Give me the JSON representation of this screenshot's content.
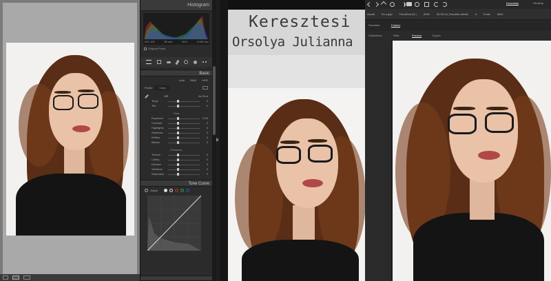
{
  "lightroom": {
    "panel_title": "Histogram",
    "original_photo_label": "Original Photo",
    "hist_info": [
      "ISO 100",
      "85 mm",
      "f/8.0",
      "1/160 sec"
    ],
    "basic_title": "Basic",
    "treatment_modes": [
      "Auto",
      "B&W",
      "HDR"
    ],
    "profile_label": "Profile",
    "profile_value": "Color",
    "wb_label": "WB",
    "wb_value": "As Shot",
    "sliders_wb": [
      {
        "label": "Temp",
        "value": "0"
      },
      {
        "label": "Tint",
        "value": "0"
      }
    ],
    "tone_title": "Tone",
    "sliders_tone": [
      {
        "label": "Exposure",
        "value": "0,00"
      },
      {
        "label": "Contrast",
        "value": "0"
      },
      {
        "label": "Highlights",
        "value": "0"
      },
      {
        "label": "Shadows",
        "value": "0"
      },
      {
        "label": "Whites",
        "value": "0"
      },
      {
        "label": "Blacks",
        "value": "0"
      }
    ],
    "presence_title": "Presence",
    "sliders_presence": [
      {
        "label": "Texture",
        "value": "0"
      },
      {
        "label": "Clarity",
        "value": "0"
      },
      {
        "label": "Dehaze",
        "value": "0"
      },
      {
        "label": "Vibrance",
        "value": "0"
      },
      {
        "label": "Saturation",
        "value": "0"
      }
    ],
    "tone_curve_title": "Tone Curve",
    "adjust_label": "Adjust"
  },
  "document": {
    "name_line1": "Keresztesi",
    "name_line2": "Orsolya Julianna"
  },
  "bridge": {
    "workspaces": [
      "Essentials",
      "Filmstrip"
    ],
    "breadcrumb": [
      "Asztal",
      "Ez a gép",
      "FotoWork (D:)",
      "2026",
      "26-03-04_Faculties tablók",
      "5",
      "Evets",
      "Mbiz"
    ],
    "favorites_label": "Favorites",
    "folders_label": "Folders",
    "panel_tabs": [
      "Collections",
      "Filter",
      "Preview",
      "Export"
    ]
  },
  "colors": {
    "accent": "#cfcfcf",
    "histogram_red": "#c03030",
    "histogram_green": "#30a040",
    "histogram_blue": "#3050c0"
  }
}
